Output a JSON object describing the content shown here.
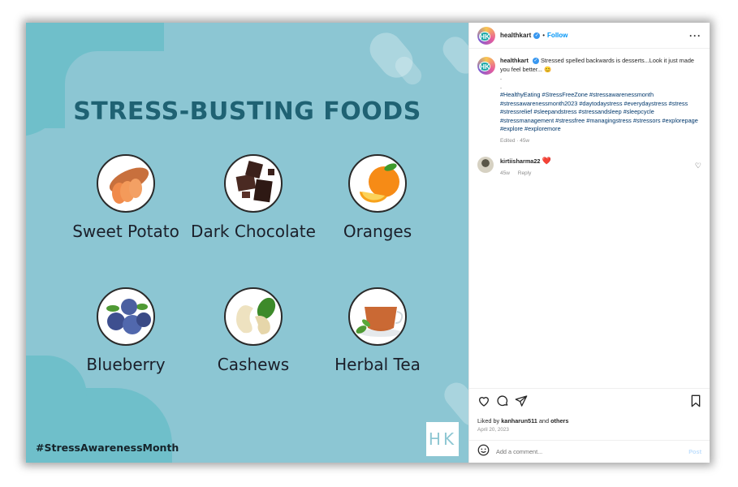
{
  "post": {
    "image": {
      "title": "STRESS-BUSTING FOODS",
      "foods": [
        {
          "name": "Sweet Potato",
          "icon": "sweet-potato-image"
        },
        {
          "name": "Dark Chocolate",
          "icon": "dark-chocolate-image"
        },
        {
          "name": "Oranges",
          "icon": "orange-image"
        },
        {
          "name": "Blueberry",
          "icon": "blueberry-image"
        },
        {
          "name": "Cashews",
          "icon": "cashew-image"
        },
        {
          "name": "Herbal Tea",
          "icon": "herbal-tea-image"
        }
      ],
      "hashtag": "#StressAwarenessMonth",
      "logo": "HK",
      "colors": {
        "background": "#8cc6d3",
        "title": "#1f6273",
        "accent": "#6fbfca"
      }
    },
    "header": {
      "avatar_text": "HK",
      "username": "healthkart",
      "follow_label": "Follow",
      "more_icon": "more-horizontal-icon"
    },
    "caption": {
      "username": "healthkart",
      "text": "Stressed spelled backwards is desserts...Look it just made you feel better...",
      "emoji": "😊",
      "dots": ".\n.",
      "hashtags": "#HealthyEating #StressFreeZone #stressawarenessmonth #stressawarenessmonth2023 #daytodaystress #everydaystress #stress #stressrelief #sleepandstress #stressandsleep #sleepcycle #stressmanagement #stressfree #managingstress #stressors #explorepage #explore #exploremore",
      "meta": "Edited · 45w"
    },
    "comments": [
      {
        "username": "kirtiisharma22",
        "text": "❤️",
        "age": "45w",
        "reply_label": "Reply"
      }
    ],
    "actions": {
      "likes_prefix": "Liked by",
      "liked_by": "kanharun511",
      "likes_conj": "and",
      "likes_others": "others",
      "date": "April 20, 2023"
    },
    "add_comment": {
      "placeholder": "Add a comment...",
      "post_label": "Post"
    }
  }
}
